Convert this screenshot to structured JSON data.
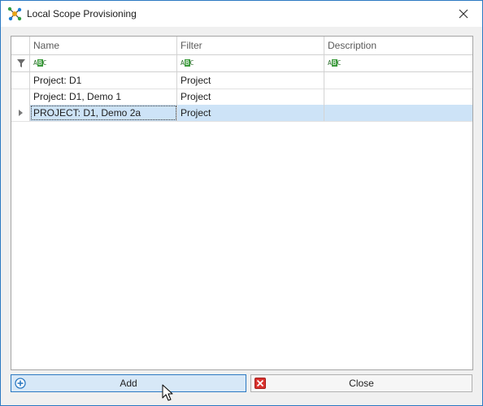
{
  "window": {
    "title": "Local Scope Provisioning"
  },
  "grid": {
    "columns": [
      "Name",
      "Filter",
      "Description"
    ],
    "rows": [
      {
        "name": "Project: D1",
        "filter": "Project",
        "description": ""
      },
      {
        "name": "Project: D1, Demo 1",
        "filter": "Project",
        "description": ""
      },
      {
        "name": "PROJECT: D1, Demo 2a",
        "filter": "Project",
        "description": ""
      }
    ],
    "selected_row": 2
  },
  "buttons": {
    "add_label": "Add",
    "close_label": "Close"
  },
  "colors": {
    "selection": "#cde3f7",
    "accent": "#2b79c2",
    "close_icon_red": "#d9322e",
    "add_icon_blue": "#2b79c2"
  },
  "icons": {
    "app": "network-nodes-icon",
    "close_window": "close-icon",
    "filter": "filter-funnel-icon",
    "text_filter": "abc-text-icon",
    "row_indicator": "row-pointer-icon",
    "add": "add-plus-circle-icon",
    "close": "close-red-x-icon",
    "cursor": "mouse-pointer-icon"
  }
}
